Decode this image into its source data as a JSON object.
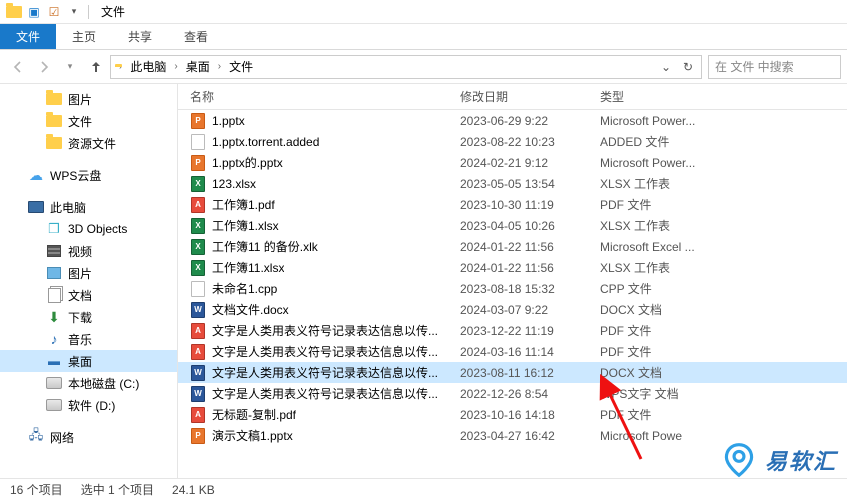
{
  "titlebar": {
    "window_title": "文件"
  },
  "ribbon": {
    "file": "文件",
    "home": "主页",
    "share": "共享",
    "view": "查看"
  },
  "address": {
    "crumbs": [
      "此电脑",
      "桌面",
      "文件"
    ],
    "search_placeholder": "在 文件 中搜索"
  },
  "tree": {
    "pictures": "图片",
    "files": "文件",
    "resources": "资源文件",
    "wps_cloud": "WPS云盘",
    "this_pc": "此电脑",
    "objects3d": "3D Objects",
    "videos": "视频",
    "pictures2": "图片",
    "documents": "文档",
    "downloads": "下载",
    "music": "音乐",
    "desktop": "桌面",
    "disk_c": "本地磁盘 (C:)",
    "disk_d": "软件 (D:)",
    "network": "网络"
  },
  "columns": {
    "name": "名称",
    "date": "修改日期",
    "type": "类型"
  },
  "files": [
    {
      "name": "1.pptx",
      "date": "2023-06-29 9:22",
      "type": "Microsoft Power...",
      "icon": "ppt"
    },
    {
      "name": "1.pptx.torrent.added",
      "date": "2023-08-22 10:23",
      "type": "ADDED 文件",
      "icon": "generic"
    },
    {
      "name": "1.pptx的.pptx",
      "date": "2024-02-21 9:12",
      "type": "Microsoft Power...",
      "icon": "ppt"
    },
    {
      "name": "123.xlsx",
      "date": "2023-05-05 13:54",
      "type": "XLSX 工作表",
      "icon": "xlsx"
    },
    {
      "name": "工作簿1.pdf",
      "date": "2023-10-30 11:19",
      "type": "PDF 文件",
      "icon": "pdf"
    },
    {
      "name": "工作簿1.xlsx",
      "date": "2023-04-05 10:26",
      "type": "XLSX 工作表",
      "icon": "xlsx"
    },
    {
      "name": "工作簿11 的备份.xlk",
      "date": "2024-01-22 11:56",
      "type": "Microsoft Excel ...",
      "icon": "xlsx"
    },
    {
      "name": "工作簿11.xlsx",
      "date": "2024-01-22 11:56",
      "type": "XLSX 工作表",
      "icon": "xlsx"
    },
    {
      "name": "未命名1.cpp",
      "date": "2023-08-18 15:32",
      "type": "CPP 文件",
      "icon": "generic"
    },
    {
      "name": "文档文件.docx",
      "date": "2024-03-07 9:22",
      "type": "DOCX 文档",
      "icon": "docx"
    },
    {
      "name": "文字是人类用表义符号记录表达信息以传...",
      "date": "2023-12-22 11:19",
      "type": "PDF 文件",
      "icon": "pdf"
    },
    {
      "name": "文字是人类用表义符号记录表达信息以传...",
      "date": "2024-03-16 11:14",
      "type": "PDF 文件",
      "icon": "pdf"
    },
    {
      "name": "文字是人类用表义符号记录表达信息以传...",
      "date": "2023-08-11 16:12",
      "type": "DOCX 文档",
      "icon": "docx",
      "selected": true
    },
    {
      "name": "文字是人类用表义符号记录表达信息以传...",
      "date": "2022-12-26 8:54",
      "type": "WPS文字 文档",
      "icon": "docx"
    },
    {
      "name": "无标题-复制.pdf",
      "date": "2023-10-16 14:18",
      "type": "PDF 文件",
      "icon": "pdf"
    },
    {
      "name": "演示文稿1.pptx",
      "date": "2023-04-27 16:42",
      "type": "Microsoft Powe",
      "icon": "ppt"
    }
  ],
  "status": {
    "total": "16 个项目",
    "selected": "选中 1 个项目",
    "size": "24.1 KB"
  },
  "watermark": "易软汇"
}
